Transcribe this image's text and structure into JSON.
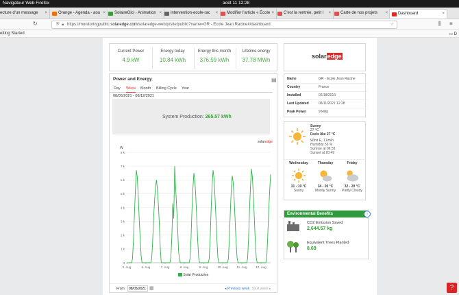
{
  "os": {
    "app_name": "Navigateur Web Firefox",
    "clock": "août 11  12:28"
  },
  "tabs": [
    {
      "label": "ecture d'un message",
      "color": "#888888"
    },
    {
      "label": "Orange - Agenda - aou",
      "color": "#f16e00"
    },
    {
      "label": "SolaireOici - Animation",
      "color": "#3c9d3c"
    },
    {
      "label": "intervention-ecole-rac",
      "color": "#666666"
    },
    {
      "label": "Modifier l'article « École",
      "color": "#e05050"
    },
    {
      "label": "C'est la rentrée, petit l",
      "color": "#e05050"
    },
    {
      "label": "Carte de nos projets",
      "color": "#e05050"
    },
    {
      "label": "Dashboard",
      "color": "#e22727"
    }
  ],
  "url": {
    "prefix": "https://monitoringpublic.",
    "host": "solaredge.com",
    "path": "/solaredge-web/p/site/public?name=GR - Ecole Jean Racine#/dashboard"
  },
  "bookmarks": {
    "left": "etting Started",
    "right": "D"
  },
  "kpis": [
    {
      "label": "Current Power",
      "value": "4.9 kW"
    },
    {
      "label": "Energy today",
      "value": "10.84 kWh"
    },
    {
      "label": "Energy this month",
      "value": "376.59 kWh"
    },
    {
      "label": "Lifetime energy",
      "value": "37.78 MWh"
    }
  ],
  "brand": {
    "solar": "solar",
    "edge": "edge"
  },
  "power_energy": {
    "title": "Power and Energy",
    "tabs": [
      "Day",
      "Week",
      "Month",
      "Billing Cycle",
      "Year"
    ],
    "active_tab": "Week",
    "date_range": "08/05/2021 - 08/12/2021",
    "system_production_label": "System Production:",
    "system_production_value": "265.57 kWh",
    "from_label": "From:",
    "from_value": "08/05/2021",
    "previous_week": "◂ Previous week",
    "next_week": "Next week ▸",
    "brand_small": "solar"
  },
  "chart_data": {
    "type": "line",
    "ylabel": "W",
    "y_ticks": [
      "0",
      "1 k",
      "2 k",
      "3 k",
      "4 k",
      "5 k",
      "6 k",
      "7 k",
      "8 k"
    ],
    "x_ticks": [
      "5. Aug",
      "6. Aug",
      "7. Aug",
      "8. Aug",
      "9. Aug",
      "10. Aug",
      "11. Aug",
      "12. Aug"
    ],
    "ylim": [
      0,
      8000
    ],
    "legend": "Solar Production",
    "color": "#2fb24a",
    "series": [
      {
        "x": [
          5.0,
          5.25,
          5.3,
          5.35,
          5.4,
          5.45,
          5.5,
          5.55,
          5.6,
          5.65,
          5.7,
          5.75,
          5.8,
          6.0,
          6.25,
          6.3,
          6.35,
          6.4,
          6.45,
          6.5,
          6.55,
          6.6,
          6.65,
          6.7,
          6.75,
          6.8,
          7.0,
          7.25,
          7.3,
          7.35,
          7.4,
          7.45,
          7.5,
          7.55,
          7.6,
          7.65,
          7.7,
          7.75,
          7.8,
          8.0,
          8.25,
          8.3,
          8.35,
          8.4,
          8.45,
          8.5,
          8.55,
          8.6,
          8.65,
          8.7,
          8.75,
          8.8,
          9.0,
          9.25,
          9.3,
          9.35,
          9.4,
          9.45,
          9.5,
          9.55,
          9.6,
          9.65,
          9.7,
          9.75,
          9.8,
          10.0,
          10.25,
          10.3,
          10.35,
          10.4,
          10.45,
          10.5,
          10.55,
          10.6,
          10.65,
          10.7,
          10.75,
          10.8,
          11.0,
          11.25,
          11.3,
          11.35,
          11.4,
          11.45,
          11.5,
          11.55,
          11.6,
          11.65,
          11.7,
          11.75,
          11.8,
          12.0,
          12.25,
          12.3,
          12.35,
          12.4,
          12.45,
          12.5
        ],
        "y": [
          0,
          0,
          300,
          1600,
          3500,
          5200,
          6700,
          6200,
          4800,
          3200,
          1800,
          500,
          0,
          0,
          0,
          300,
          1500,
          3200,
          4500,
          5500,
          6000,
          5300,
          4200,
          2800,
          1000,
          0,
          0,
          0,
          400,
          1800,
          4300,
          3200,
          7000,
          5500,
          4100,
          2600,
          900,
          200,
          0,
          0,
          0,
          300,
          1700,
          3800,
          5400,
          6500,
          6000,
          4800,
          3200,
          1600,
          400,
          0,
          0,
          0,
          300,
          1800,
          3900,
          5600,
          6700,
          6100,
          4800,
          3300,
          1700,
          400,
          0,
          0,
          0,
          300,
          1700,
          3700,
          5300,
          6300,
          5800,
          4600,
          3100,
          1500,
          400,
          0,
          0,
          0,
          300,
          1700,
          3800,
          5500,
          6800,
          6200,
          4900,
          3300,
          1600,
          400,
          0,
          0,
          0,
          400,
          1900,
          3700,
          5200,
          6400
        ]
      }
    ]
  },
  "site": {
    "rows": [
      {
        "key": "Name",
        "value": "GR - Ecole Jean Racine"
      },
      {
        "key": "Country",
        "value": "France"
      },
      {
        "key": "Installed",
        "value": "02/18/2016"
      },
      {
        "key": "Last Updated",
        "value": "08/11/2021 12:28"
      },
      {
        "key": "Peak Power",
        "value": "9 kWp"
      }
    ]
  },
  "weather": {
    "now": {
      "condition": "Sunny",
      "temp": "27 °C",
      "feels": "Feels like 27 °C",
      "details": [
        "Wind E, 1 km/h",
        "Humidity 53 %",
        "Sunrise at 06:33",
        "Sunset at 20:49"
      ]
    },
    "days": [
      {
        "name": "Wednesday",
        "temp": "31 - 19 °C",
        "cond": "Sunny"
      },
      {
        "name": "Thursday",
        "temp": "34 - 20 °C",
        "cond": "Mostly Sunny"
      },
      {
        "name": "Friday",
        "temp": "32 - 20 °C",
        "cond": "Partly Cloudy"
      }
    ]
  },
  "environment": {
    "title": "Environmental Benefits",
    "co2_label": "CO2 Emission Saved",
    "co2_value": "2,644.57 kg",
    "trees_label": "Equivalent Trees Planted",
    "trees_value": "8.69"
  },
  "help": {
    "label": "?"
  }
}
